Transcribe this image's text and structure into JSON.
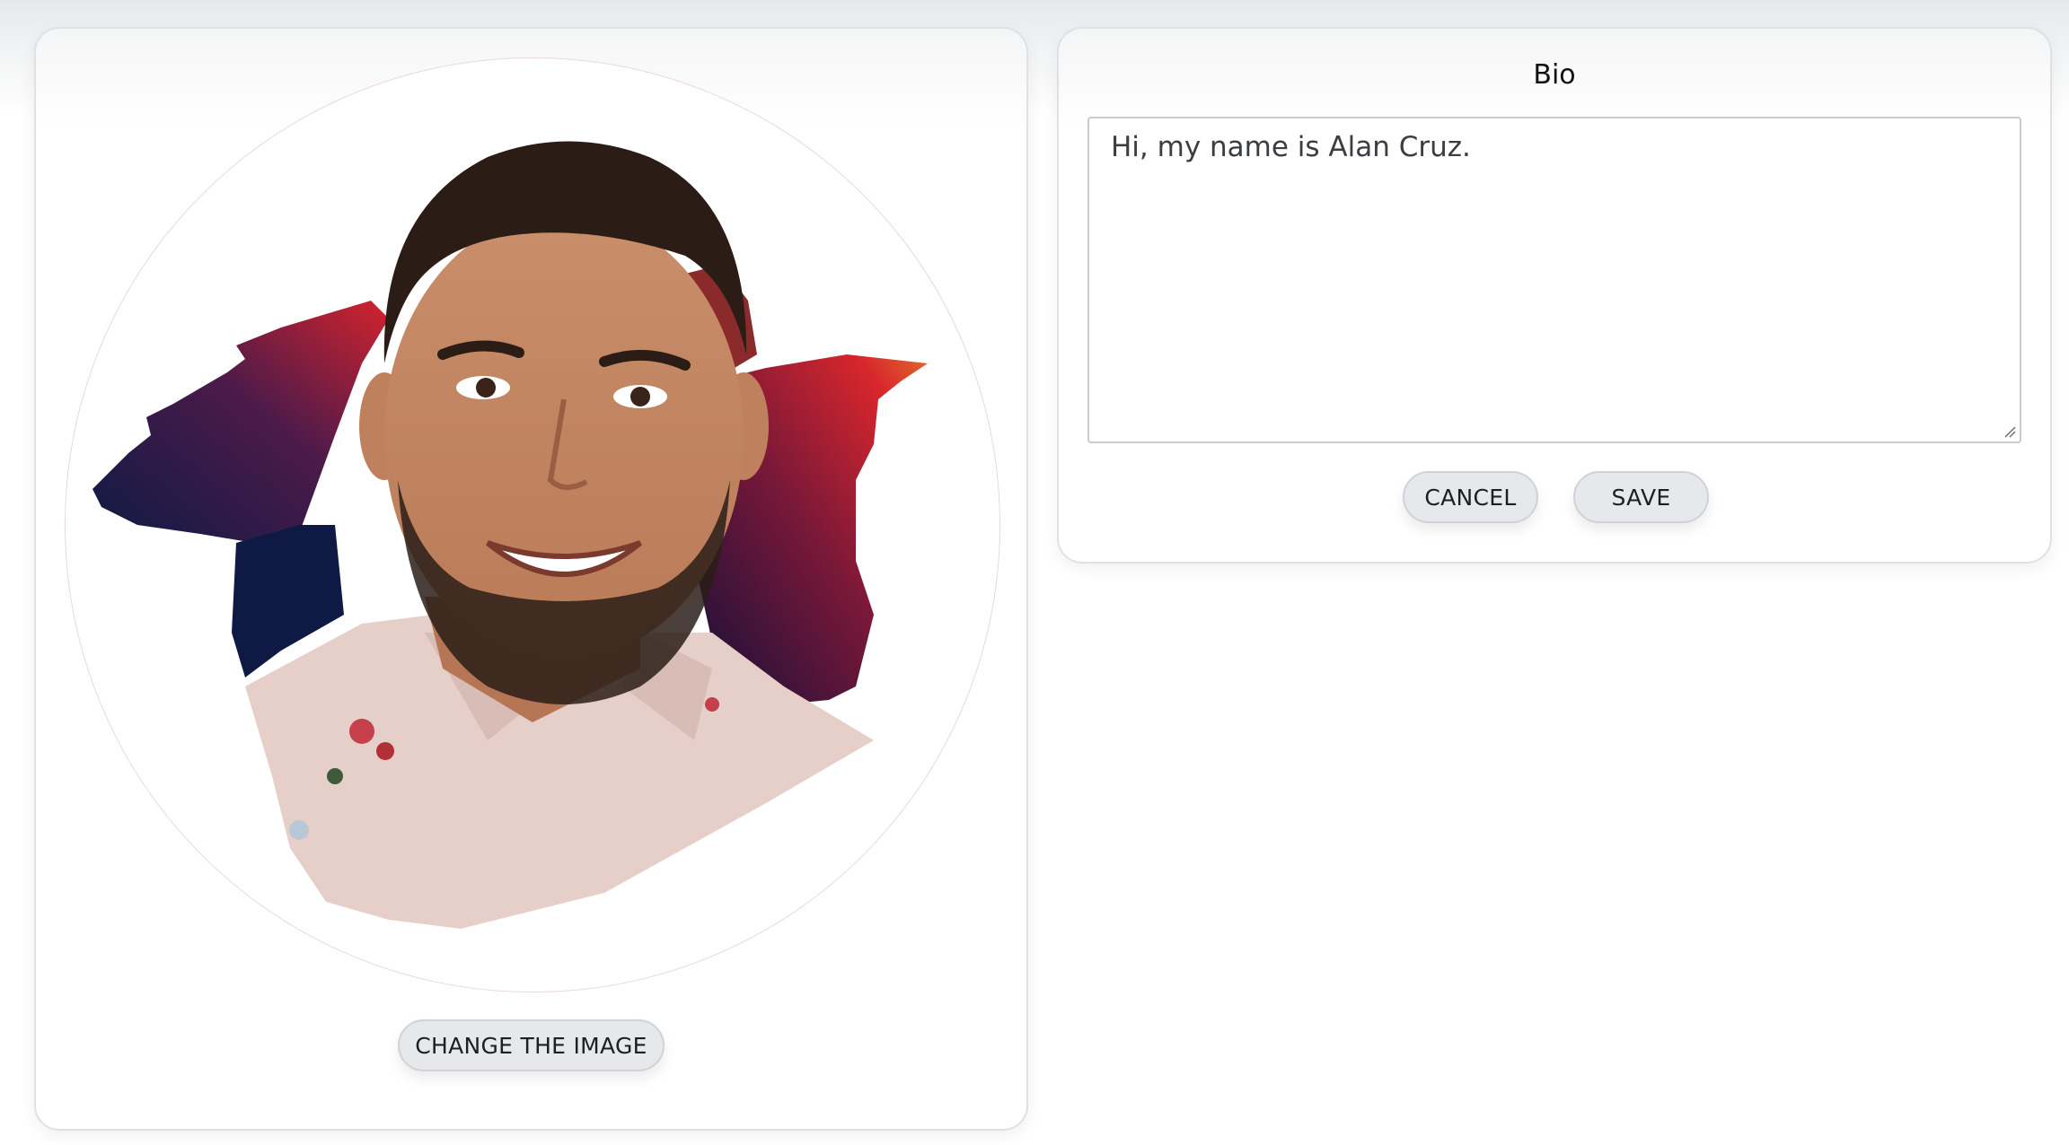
{
  "profile": {
    "avatar_alt": "Profile photo",
    "change_image_label": "CHANGE THE IMAGE"
  },
  "bio": {
    "title": "Bio",
    "text": "Hi, my name is Alan Cruz.",
    "cancel_label": "CANCEL",
    "save_label": "SAVE"
  },
  "colors": {
    "button_bg": "#e6e8eb",
    "button_border": "#cfd3d8",
    "card_border": "#dfe1e4",
    "brush_dark": "#0f1840",
    "brush_red": "#c8202c"
  },
  "icons": {
    "resize_grip": "resize-grip-icon"
  }
}
